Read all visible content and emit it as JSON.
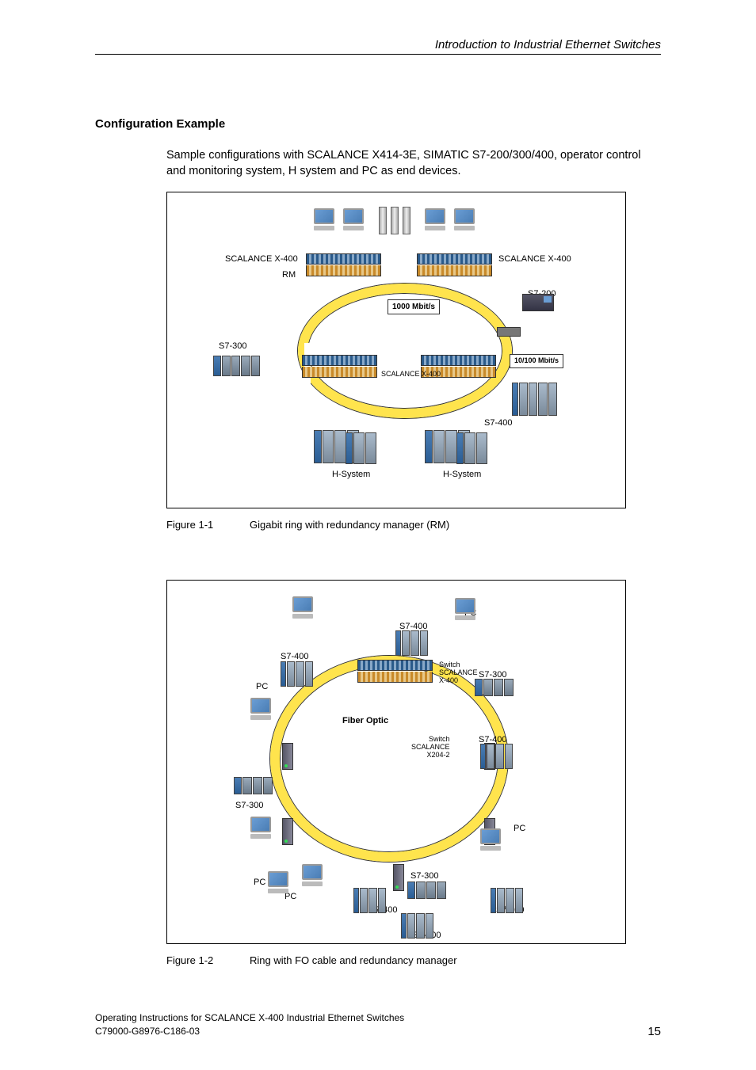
{
  "header": "Introduction to Industrial Ethernet Switches",
  "section_title": "Configuration Example",
  "intro": "Sample configurations with SCALANCE X414-3E, SIMATIC S7-200/300/400, operator control and monitoring system, H system and PC as end devices.",
  "figure1": {
    "label": "Figure 1-1",
    "caption": "Gigabit ring with redundancy manager (RM)",
    "speed_main": "1000 Mbit/s",
    "speed_branch": "10/100 Mbit/s",
    "scalance_left": "SCALANCE X-400",
    "scalance_right": "SCALANCE X-400",
    "scalance_mid": "SCALANCE X-400",
    "rm": "RM",
    "s7300": "S7-300",
    "s7200": "S7-200",
    "s7400": "S7-400",
    "hsystem_a": "H-System",
    "hsystem_b": "H-System"
  },
  "figure2": {
    "label": "Figure 1-2",
    "caption": "Ring with FO cable and redundancy manager",
    "fiber": "Fiber Optic",
    "pc": "PC",
    "s7400": "S7-400",
    "s7300": "S7-300",
    "switch_x400": "Switch SCALANCE X-400",
    "switch_x204": "Switch SCALANCE X204-2"
  },
  "footer": {
    "line1": "Operating Instructions for SCALANCE X-400 Industrial Ethernet Switches",
    "line2": "C79000-G8976-C186-03",
    "page": "15"
  }
}
